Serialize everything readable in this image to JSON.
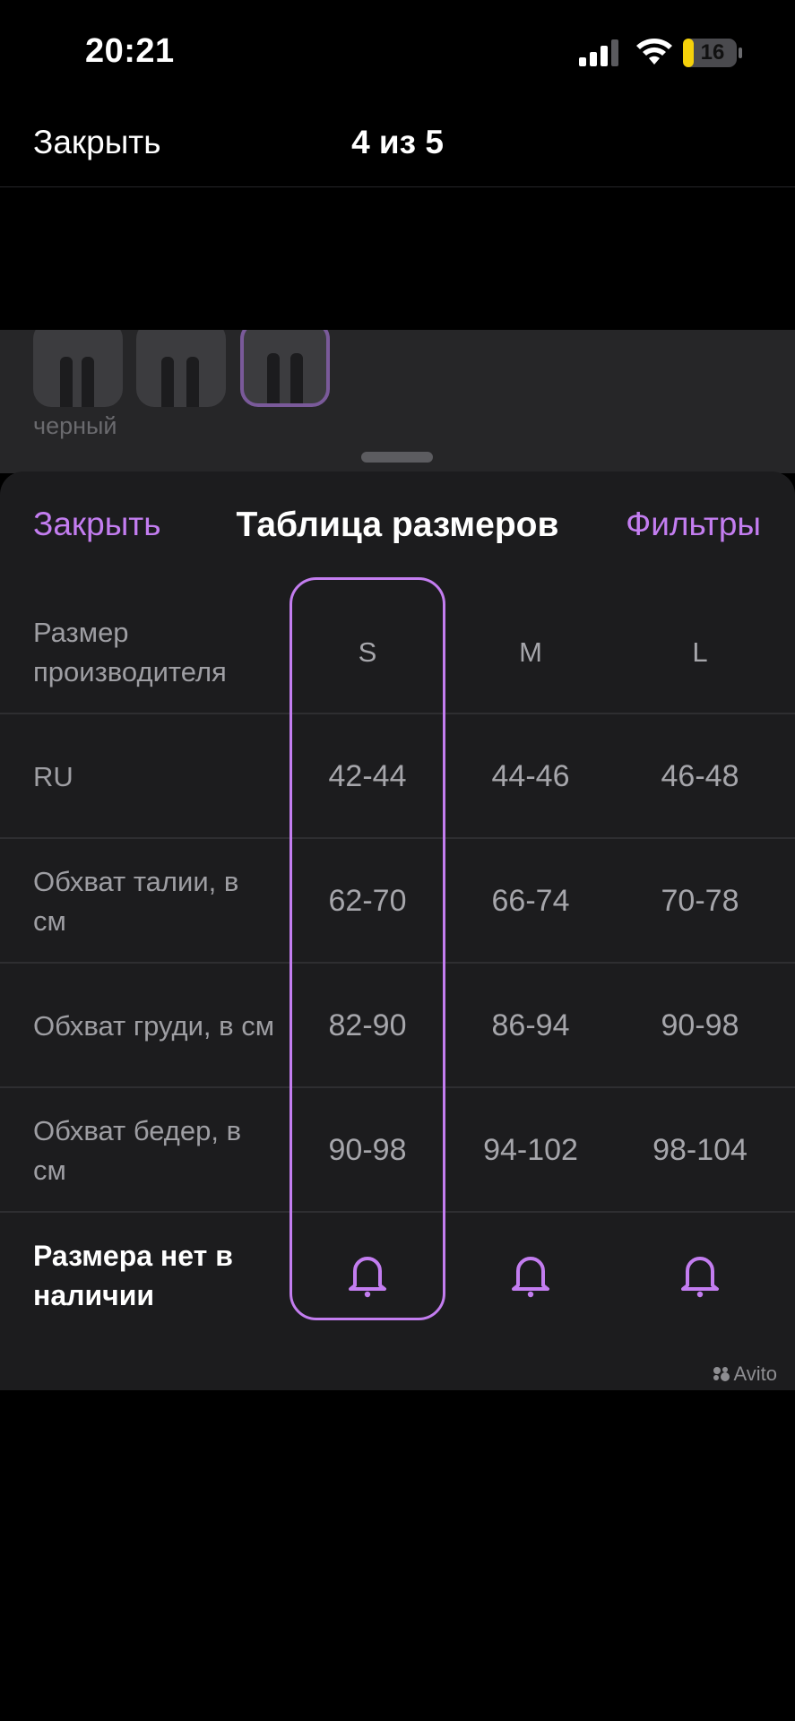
{
  "status_bar": {
    "time": "20:21",
    "battery": "16"
  },
  "top_nav": {
    "close_label": "Закрыть",
    "counter": "4 из 5"
  },
  "background_page": {
    "color_label": "черный"
  },
  "sheet": {
    "close_label": "Закрыть",
    "title": "Таблица размеров",
    "filters_label": "Фильтры",
    "selected_size": "S",
    "header": {
      "label": "Размер производителя",
      "sizes": [
        "S",
        "M",
        "L"
      ]
    },
    "rows": [
      {
        "label": "RU",
        "values": [
          "42-44",
          "44-46",
          "46-48"
        ]
      },
      {
        "label": "Обхват талии, в см",
        "values": [
          "62-70",
          "66-74",
          "70-78"
        ]
      },
      {
        "label": "Обхват груди, в см",
        "values": [
          "82-90",
          "86-94",
          "90-98"
        ]
      },
      {
        "label": "Обхват бедер, в см",
        "values": [
          "90-98",
          "94-102",
          "98-104"
        ]
      }
    ],
    "out_of_stock_label": "Размера нет в наличии",
    "watermark": "Avito"
  },
  "colors": {
    "accent": "#c37df0",
    "sheet_bg": "#1c1c1e",
    "battery": "#f5d10a"
  }
}
